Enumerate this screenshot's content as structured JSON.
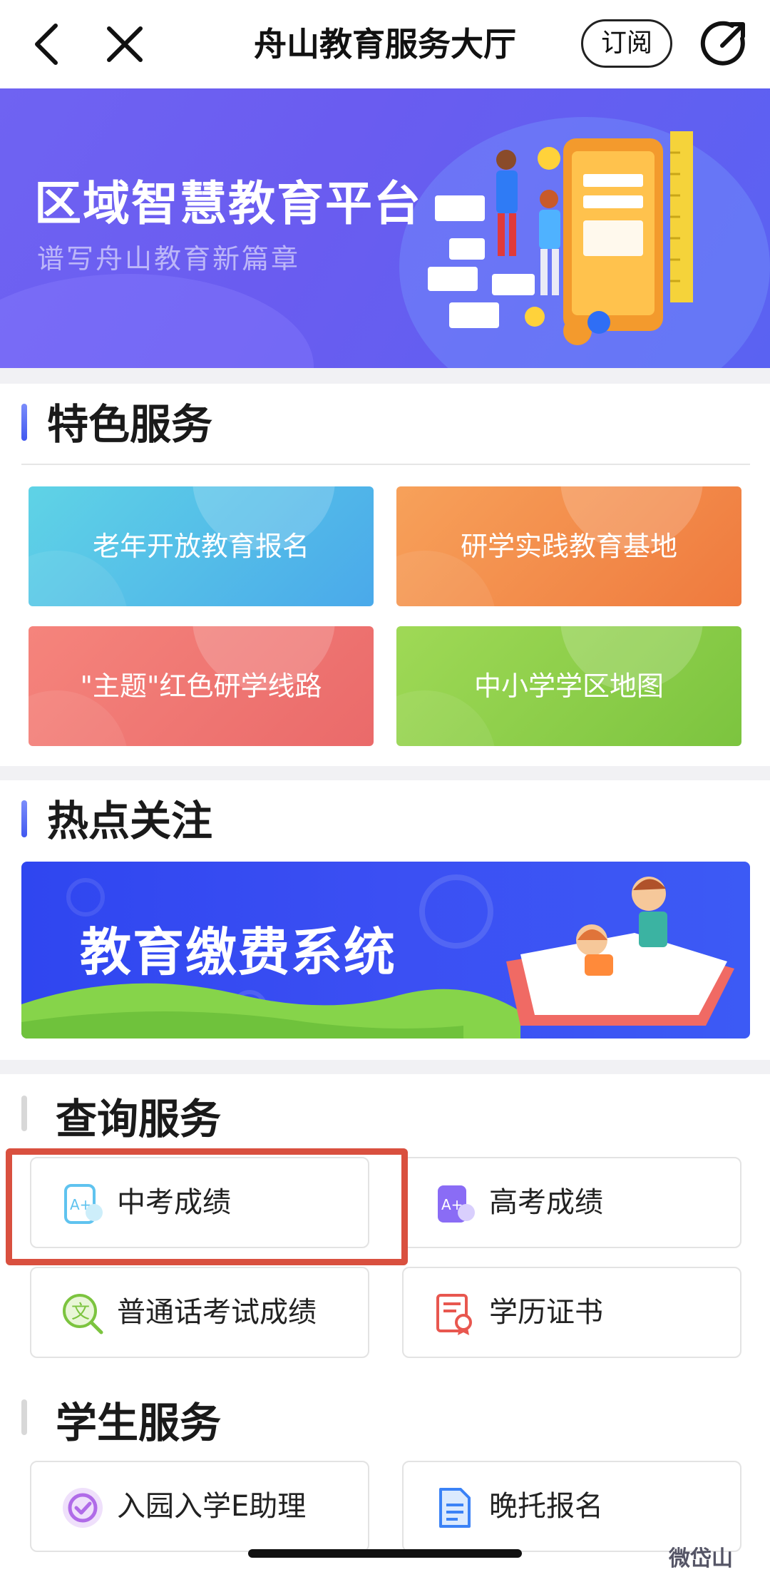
{
  "nav": {
    "title": "舟山教育服务大厅",
    "subscribe": "订阅"
  },
  "hero": {
    "title": "区域智慧教育平台",
    "subtitle": "谱写舟山教育新篇章"
  },
  "featured": {
    "title": "特色服务",
    "tiles": [
      {
        "label": "老年开放教育报名",
        "color_from": "#3fc7e0",
        "color_to": "#46a8e8"
      },
      {
        "label": "研学实践教育基地",
        "color_from": "#f48a3a",
        "color_to": "#ef7a3e"
      },
      {
        "label": "\"主题\"红色研学线路",
        "color_from": "#f0736e",
        "color_to": "#e86a6a"
      },
      {
        "label": "中小学学区地图",
        "color_from": "#92d04a",
        "color_to": "#7cc43f"
      }
    ]
  },
  "hot": {
    "title": "热点关注",
    "banner_title": "教育缴费系统"
  },
  "query": {
    "title": "查询服务",
    "items": [
      {
        "label": "中考成绩",
        "icon": "grade-a-plus-icon"
      },
      {
        "label": "高考成绩",
        "icon": "grade-a-plus-purple-icon"
      },
      {
        "label": "普通话考试成绩",
        "icon": "mandarin-text-search-icon"
      },
      {
        "label": "学历证书",
        "icon": "certificate-icon"
      }
    ]
  },
  "student": {
    "title": "学生服务",
    "items": [
      {
        "label": "入园入学E助理",
        "icon": "enrollment-icon"
      },
      {
        "label": "晚托报名",
        "icon": "document-icon"
      }
    ]
  },
  "watermark": "微岱山"
}
